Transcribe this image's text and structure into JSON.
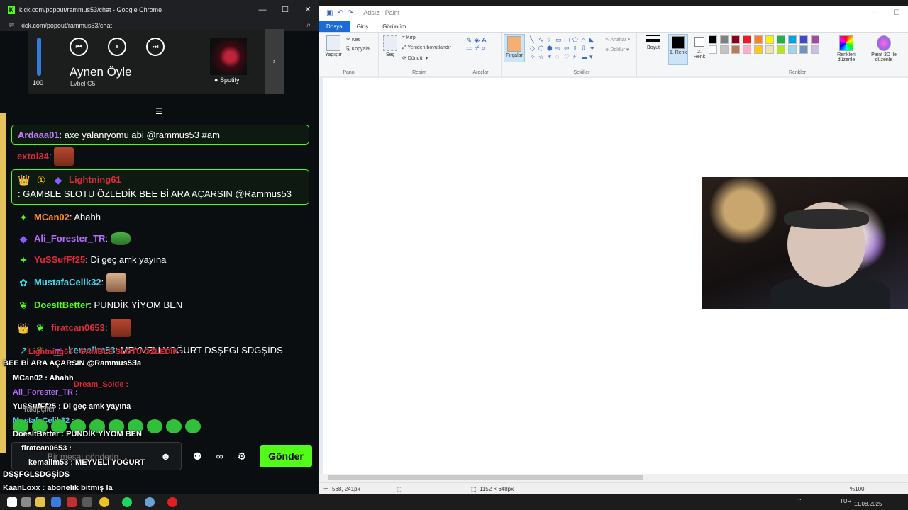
{
  "chrome": {
    "title": "kick.com/popout/rammus53/chat - Google Chrome",
    "url": "kick.com/popout/rammus53/chat",
    "min": "—",
    "max": "☐",
    "close": "✕"
  },
  "spotify": {
    "volume": 100,
    "volume_label": "100",
    "song": "Aynen Öyle",
    "artist": "Lvbel C5",
    "brand": "Spotify",
    "prev": "⏮",
    "pause": "⏸",
    "next": "⏭",
    "expand": "›"
  },
  "chat": [
    {
      "user": "Ardaaa01",
      "color": "#c77dff",
      "text": ": axe yalanıyomu abi @rammus53 #am",
      "highlight": true
    },
    {
      "user": "extol34",
      "color": "#e0283a",
      "text": ":",
      "emote": "face"
    },
    {
      "badges": [
        "👑",
        "①",
        "◆"
      ],
      "user": "Lightning61",
      "color": "#e0283a",
      "text": ": GAMBLE SLOTU ÖZLEDİK BEE Bİ ARA AÇARSIN @Rammus53",
      "highlight": true
    },
    {
      "badges": [
        "✦"
      ],
      "user": "MCan02",
      "color": "#ff8a2a",
      "text": ": Ahahh"
    },
    {
      "badges": [
        "◆"
      ],
      "user": "Ali_Forester_TR",
      "color": "#b56cff",
      "text": ":",
      "emote": "frog"
    },
    {
      "badges": [
        "✦"
      ],
      "user": "YuSSufFf25",
      "color": "#e0283a",
      "text": ": Di geç amk yayına"
    },
    {
      "badges": [
        "✿"
      ],
      "user": "MustafaCelik32",
      "color": "#46d9f0",
      "text": ":",
      "emote": "man"
    },
    {
      "badges": [
        "❦"
      ],
      "user": "DoesItBetter",
      "color": "#53fc18",
      "text": ": PUNDİK YİYOM BEN"
    },
    {
      "badges": [
        "👑",
        "❦"
      ],
      "user": "firatcan0653",
      "color": "#e0283a",
      "text": ":",
      "emote": "face"
    },
    {
      "badges": [
        "↗",
        "❦",
        "▣"
      ],
      "user": "kemalim53",
      "color": "#46d9f0",
      "text": ": MEYVELİ YOĞURT DSŞFGLSDGŞİDS"
    }
  ],
  "overlay": {
    "l1": "Lightning61 : GAMBLE SLOTU ÖZLEDİK",
    "l2": "BEE Bİ ARA AÇARSIN @Rammus53",
    "l2b": "la",
    "l3": "MCan02 : Ahahh",
    "l3b": "Dream_Solde :",
    "l4": "Ali_Forester_TR :",
    "l5": "YuSSufFf25 : Di geç amk yayına",
    "l5b": "Takipçiler",
    "l6": "MustafaCelik32 :",
    "l7": "DoesItBetter : PUNDİK YİYOM BEN",
    "l8": "firatcan0653 :",
    "l9": "kemalim53 : MEYVELİ YOĞURT",
    "l10": "DSŞFGLSDGŞİDS",
    "l11": "KaanLoxx : abonelik bitmiş la"
  },
  "input": {
    "placeholder": "Bir mesaj gönderin",
    "send": "Gönder",
    "emoji": "☻",
    "tools": [
      "⚉",
      "∞",
      "⚙"
    ]
  },
  "paint": {
    "title": "Adsız - Paint",
    "tabs": [
      "Dosya",
      "Giriş",
      "Görünüm"
    ],
    "paste": "Yapıştır",
    "cut": "Kes",
    "copy": "Kopyala",
    "group_clipboard": "Pano",
    "select": "Seç",
    "crop": "Kırp",
    "resize": "Yeniden boyutlandır",
    "rotate": "Döndür",
    "group_image": "Resim",
    "group_tools": "Araçlar",
    "brushes": "Fırçalar",
    "outline": "Anahat",
    "fill": "Doldur",
    "group_shapes": "Şekiller",
    "size": "Boyut",
    "color1": "1. Renk",
    "color2": "2. Renk",
    "edit_colors": "Renkleri düzenle",
    "paint3d": "Paint 3D ile düzenle",
    "group_colors": "Renkler",
    "coords": "568, 241px",
    "canvas_size": "1152 × 648px",
    "zoom": "%100"
  },
  "palette": [
    "#000000",
    "#7f7f7f",
    "#880015",
    "#ed1c24",
    "#ff7f27",
    "#fff200",
    "#22b14c",
    "#00a2e8",
    "#3f48cc",
    "#a349a4",
    "#ffffff",
    "#c3c3c3",
    "#b97a57",
    "#ffaec9",
    "#ffc90e",
    "#efe4b0",
    "#b5e61d",
    "#99d9ea",
    "#7092be",
    "#c8bfe7"
  ],
  "taskbar": {
    "date": "11.08.2025",
    "lang": "TUR"
  }
}
